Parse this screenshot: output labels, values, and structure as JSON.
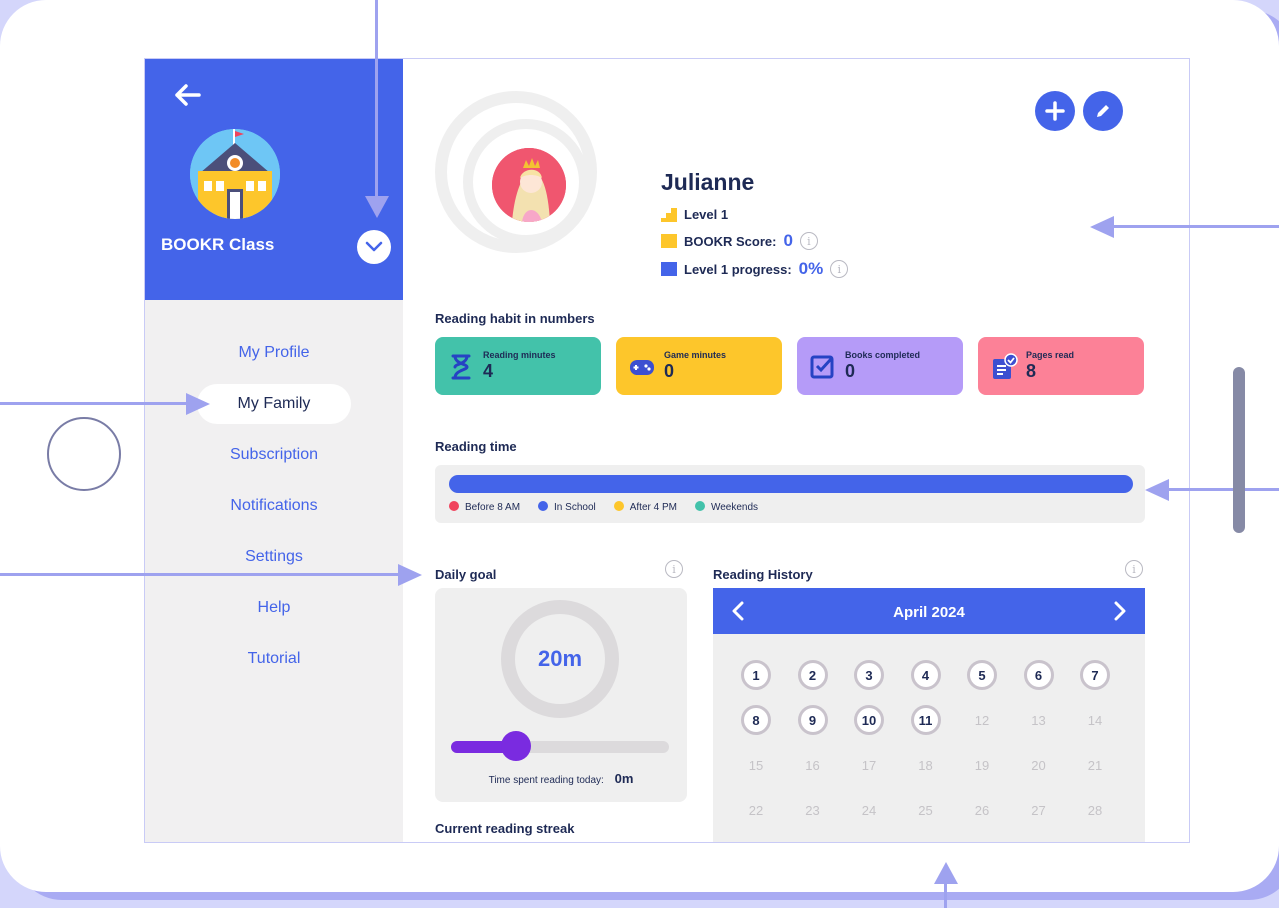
{
  "sidebar": {
    "class_name": "BOOKR Class",
    "menu": [
      {
        "label": "My Profile"
      },
      {
        "label": "My Family"
      },
      {
        "label": "Subscription"
      },
      {
        "label": "Notifications"
      },
      {
        "label": "Settings"
      },
      {
        "label": "Help"
      },
      {
        "label": "Tutorial"
      }
    ],
    "active_item": "My Family"
  },
  "profile": {
    "name": "Julianne",
    "level": "Level 1",
    "score_label": "BOOKR Score:",
    "score_value": "0",
    "progress_label": "Level 1 progress:",
    "progress_value": "0%",
    "info_glyph": "i"
  },
  "reading_habit": {
    "title": "Reading habit in numbers",
    "cards": [
      {
        "label": "Reading minutes",
        "value": "4",
        "color": "#43c2aa",
        "icon": "hourglass-icon"
      },
      {
        "label": "Game minutes",
        "value": "0",
        "color": "#fdc62b",
        "icon": "gamepad-icon"
      },
      {
        "label": "Books completed",
        "value": "0",
        "color": "#b59bf8",
        "icon": "checkbox-icon"
      },
      {
        "label": "Pages read",
        "value": "8",
        "color": "#fc8197",
        "icon": "document-check-icon"
      }
    ]
  },
  "reading_time": {
    "title": "Reading time",
    "legend": [
      {
        "label": "Before 8 AM",
        "color": "#f0435d"
      },
      {
        "label": "In School",
        "color": "#4464e9"
      },
      {
        "label": "After 4 PM",
        "color": "#fdc62b"
      },
      {
        "label": "Weekends",
        "color": "#43c2aa"
      }
    ]
  },
  "daily_goal": {
    "title": "Daily goal",
    "goal_value": "20m",
    "slider_fraction": 0.3,
    "caption": "Time spent reading today:",
    "today_value": "0m"
  },
  "reading_history": {
    "title": "Reading History",
    "month": "April 2024",
    "read_days": [
      "1",
      "2",
      "3",
      "4",
      "5",
      "6",
      "7",
      "8",
      "9",
      "10",
      "11"
    ],
    "other_days": [
      "12",
      "13",
      "14",
      "15",
      "16",
      "17",
      "18",
      "19",
      "20",
      "21",
      "22",
      "23",
      "24",
      "25",
      "26",
      "27",
      "28"
    ]
  },
  "streak": {
    "title": "Current reading streak"
  },
  "colors": {
    "brand_blue": "#4464e9",
    "text_dark": "#1e2a55",
    "slider_purple": "#7a2be0"
  }
}
